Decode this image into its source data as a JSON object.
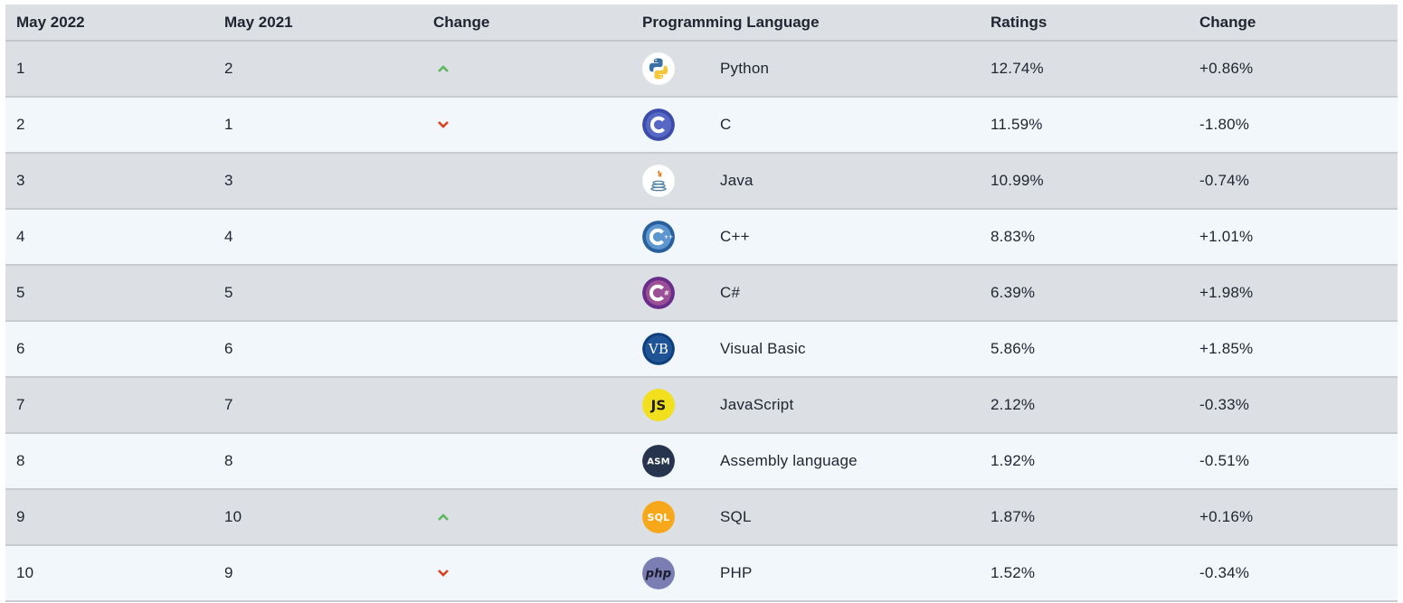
{
  "header": {
    "col_current": "May 2022",
    "col_previous": "May 2021",
    "col_change": "Change",
    "col_language": "Programming Language",
    "col_ratings": "Ratings",
    "col_change2": "Change"
  },
  "rows": [
    {
      "current": "1",
      "previous": "2",
      "trend": "up",
      "logo": "python-icon",
      "language": "Python",
      "rating": "12.74%",
      "change": "+0.86%"
    },
    {
      "current": "2",
      "previous": "1",
      "trend": "down",
      "logo": "c-icon",
      "language": "C",
      "rating": "11.59%",
      "change": "-1.80%"
    },
    {
      "current": "3",
      "previous": "3",
      "trend": "none",
      "logo": "java-icon",
      "language": "Java",
      "rating": "10.99%",
      "change": "-0.74%"
    },
    {
      "current": "4",
      "previous": "4",
      "trend": "none",
      "logo": "cplusplus-icon",
      "language": "C++",
      "rating": "8.83%",
      "change": "+1.01%"
    },
    {
      "current": "5",
      "previous": "5",
      "trend": "none",
      "logo": "csharp-icon",
      "language": "C#",
      "rating": "6.39%",
      "change": "+1.98%"
    },
    {
      "current": "6",
      "previous": "6",
      "trend": "none",
      "logo": "visual-basic-icon",
      "language": "Visual Basic",
      "rating": "5.86%",
      "change": "+1.85%"
    },
    {
      "current": "7",
      "previous": "7",
      "trend": "none",
      "logo": "javascript-icon",
      "language": "JavaScript",
      "rating": "2.12%",
      "change": "-0.33%"
    },
    {
      "current": "8",
      "previous": "8",
      "trend": "none",
      "logo": "assembly-icon",
      "language": "Assembly language",
      "rating": "1.92%",
      "change": "-0.51%"
    },
    {
      "current": "9",
      "previous": "10",
      "trend": "up",
      "logo": "sql-icon",
      "language": "SQL",
      "rating": "1.87%",
      "change": "+0.16%"
    },
    {
      "current": "10",
      "previous": "9",
      "trend": "down",
      "logo": "php-icon",
      "language": "PHP",
      "rating": "1.52%",
      "change": "-0.34%"
    }
  ],
  "logo_text": {
    "vb": "VB",
    "js": "JS",
    "asm": "ASM",
    "sql": "SQL",
    "php": "php"
  },
  "colors": {
    "up_arrow": "#5cb85c",
    "down_arrow": "#d9411e",
    "row_odd": "#dcdfe3",
    "row_even": "#f2f7fc"
  }
}
